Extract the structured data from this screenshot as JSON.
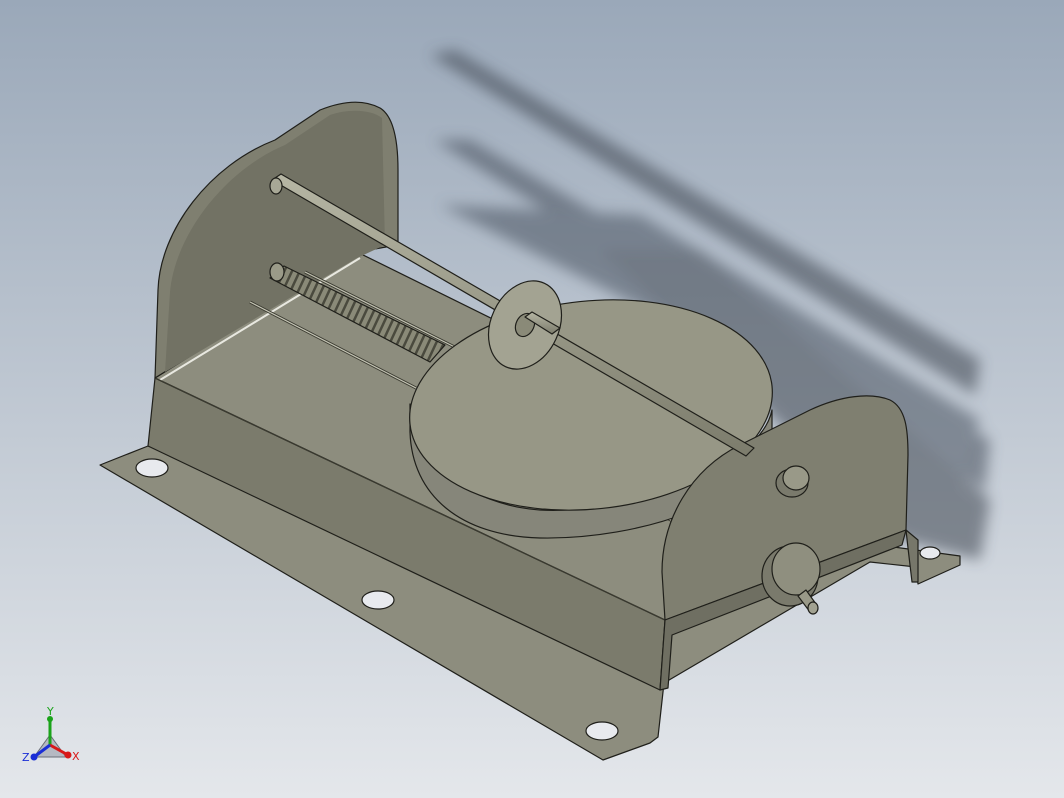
{
  "viewport": {
    "background": {
      "top": "#9aa8b9",
      "bottom": "#e4e7eb"
    },
    "model": {
      "parts": [
        {
          "name": "base-plate",
          "color": "#8d8d7e"
        },
        {
          "name": "left-end-plate",
          "color": "#7f7f70"
        },
        {
          "name": "right-end-plate",
          "color": "#7f7f70"
        },
        {
          "name": "guide-rod",
          "color": "#a0a08f"
        },
        {
          "name": "lead-screw",
          "color": "#8a8a78"
        },
        {
          "name": "rotary-disc",
          "color": "#979786"
        },
        {
          "name": "washer",
          "color": "#a3a392"
        },
        {
          "name": "knob",
          "color": "#8f8f7f"
        },
        {
          "name": "crank-handle",
          "color": "#8f8f7f"
        }
      ],
      "edge_color": "#1f1f1a"
    },
    "triad": {
      "x_label": "X",
      "y_label": "Y",
      "z_label": "Z",
      "x_color": "#d81818",
      "y_color": "#1aa31a",
      "z_color": "#1a2ed6"
    }
  }
}
